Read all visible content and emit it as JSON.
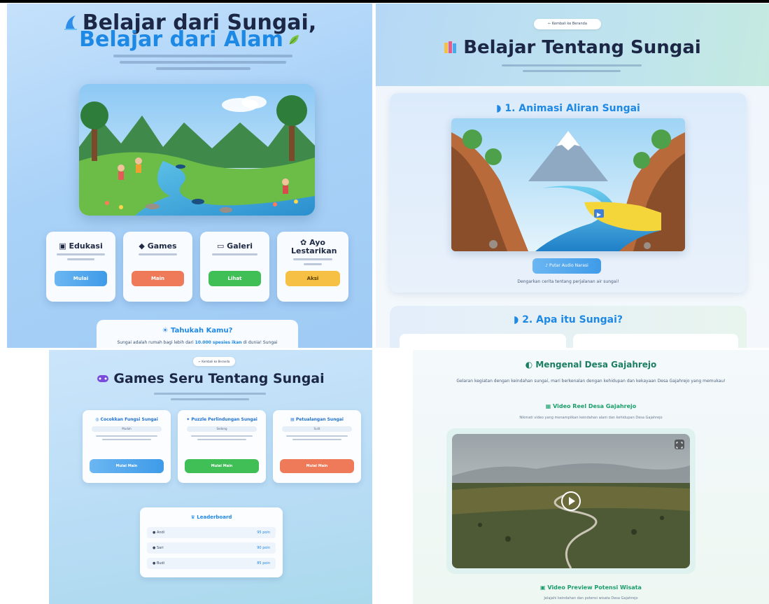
{
  "home": {
    "title_line1": "Belajar dari Sungai,",
    "title_line2": "Belajar dari Alam",
    "cards": [
      {
        "label": "Edukasi",
        "button": "Mulai",
        "color": "#4aa8ef"
      },
      {
        "label": "Games",
        "button": "Main",
        "color": "#ef7a5a"
      },
      {
        "label": "Galeri",
        "button": "Lihat",
        "color": "#3fbf55"
      },
      {
        "label": "Ayo Lestarikan",
        "button": "Aksi",
        "color": "#f5c043"
      }
    ],
    "fact_title": "Tahukah Kamu?",
    "fact_text_before": "Sungai adalah rumah bagi lebih dari",
    "fact_highlight": "10.000 spesies ikan",
    "fact_text_after": "di dunia! Sungai"
  },
  "learn": {
    "back_label": "← Kembali ke Beranda",
    "title": "Belajar Tentang Sungai",
    "section1_title": "1. Animasi Aliran Sungai",
    "play_label": "Putar Audio Narasi",
    "caption": "Dengarkan cerita tentang perjalanan air sungai!",
    "section2_title": "2. Apa itu Sungai?"
  },
  "games": {
    "back_label": "← Kembali ke Beranda",
    "title": "Games Seru Tentang Sungai",
    "cards": [
      {
        "title": "Cocokkan Fungsi Sungai",
        "level": "Mudah",
        "button": "Mulai Main",
        "color": "#4aa8ef"
      },
      {
        "title": "Puzzle Perlindungan Sungai",
        "level": "Sedang",
        "button": "Mulai Main",
        "color": "#3fbf55"
      },
      {
        "title": "Petualangan Sungai",
        "level": "Sulit",
        "button": "Mulai Main",
        "color": "#ef7a5a"
      }
    ],
    "leaderboard_title": "Leaderboard",
    "leaderboard": [
      {
        "name": "Andi",
        "score": "95 poin"
      },
      {
        "name": "Sari",
        "score": "90 poin"
      },
      {
        "name": "Budi",
        "score": "85 poin"
      }
    ]
  },
  "village": {
    "title": "Mengenal Desa Gajahrejo",
    "desc": "Gelaran kegiatan dengan keindahan sungai, mari berkenalan dengan kehidupan dan kekayaan Desa Gajahrejo yang memukau!",
    "video_title": "Video Reel Desa Gajahrejo",
    "video_caption": "Nikmati video yang menampilkan keindahan alam dan kehidupan Desa Gajahrejo",
    "video2_title": "Video Preview Potensi Wisata",
    "video2_caption": "Jelajahi keindahan dan potensi wisata Desa Gajahrejo"
  }
}
